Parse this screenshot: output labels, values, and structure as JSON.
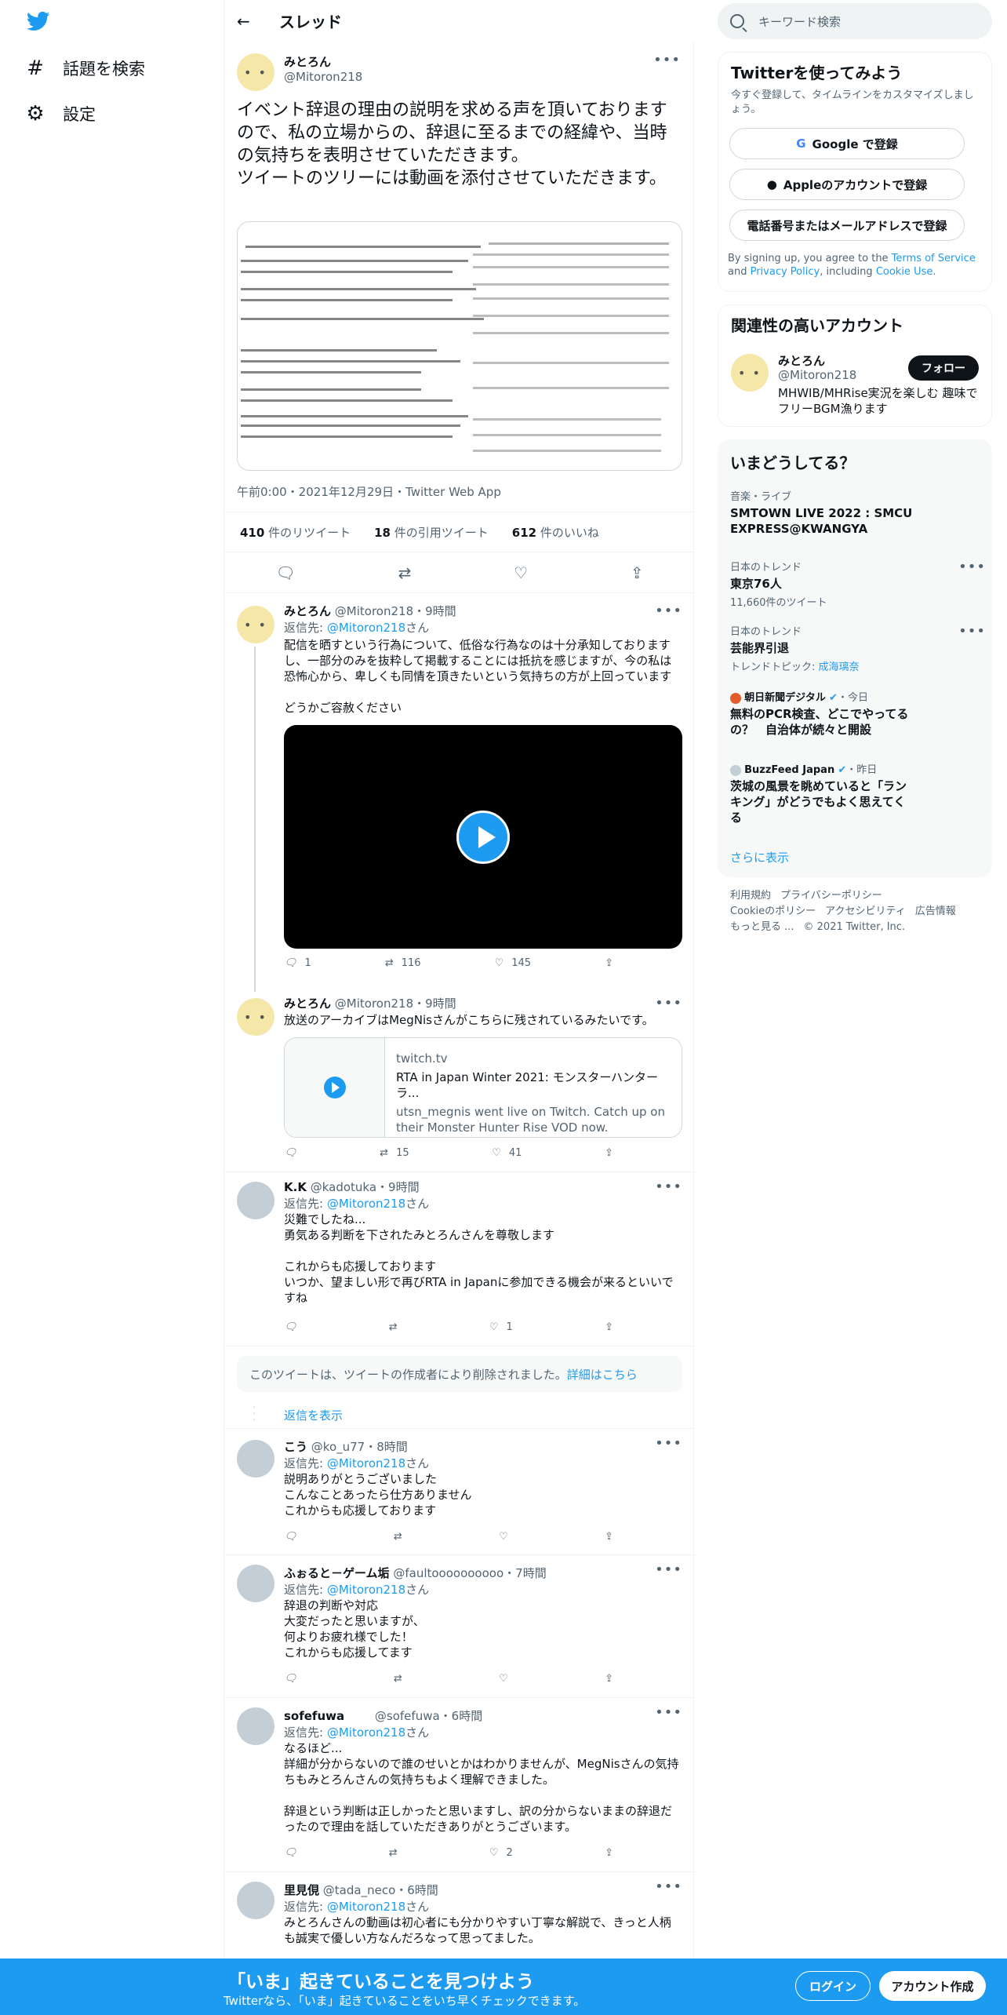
{
  "nav": {
    "explore": "話題を検索",
    "settings": "設定"
  },
  "header": {
    "title": "スレッド"
  },
  "main_tweet": {
    "name": "みとろん",
    "handle": "@Mitoron218",
    "text": "イベント辞退の理由の説明を求める声を頂いておりますので、私の立場からの、辞退に至るまでの経緯や、当時の気持ちを表明させていただきます。\nツイートのツリーには動画を添付させていただきます。",
    "meta": "午前0:00・2021年12月29日・Twitter Web App",
    "retweets": "410",
    "retweets_label": "件のリツイート",
    "quotes": "18",
    "quotes_label": "件の引用ツイート",
    "likes": "612",
    "likes_label": "件のいいね"
  },
  "replies": [
    {
      "name": "みとろん",
      "handle": "@Mitoron218・9時間",
      "reply_to_prefix": "返信先: ",
      "reply_to": "@Mitoron218",
      "reply_to_suffix": "さん",
      "text": "配信を晒すという行為について、低俗な行為なのは十分承知しております し、一部分のみを抜粋して掲載することには抵抗を感じますが、今の私は 恐怖心から、卑しくも同情を頂きたいという気持ちの方が上回っています\n\nどうかご容赦ください",
      "replies": "1",
      "retweets": "116",
      "likes": "145"
    },
    {
      "name": "みとろん",
      "handle": "@Mitoron218・9時間",
      "text": "放送のアーカイブはMegNisさんがこちらに残されているみたいです。",
      "card_domain": "twitch.tv",
      "card_title": "RTA in Japan Winter 2021: モンスターハンターラ...",
      "card_desc": "utsn_megnis went live on Twitch. Catch up on their Monster Hunter Rise VOD now.",
      "replies": "",
      "retweets": "15",
      "likes": "41"
    },
    {
      "name": "K.K",
      "handle": "@kadotuka・9時間",
      "reply_to_prefix": "返信先: ",
      "reply_to": "@Mitoron218",
      "reply_to_suffix": "さん",
      "text": "災難でしたね...\n勇気ある判断を下されたみとろんさんを尊敬します\n\nこれからも応援しております\nいつか、望ましい形で再びRTA in Japanに参加できる機会が来るといいで すね",
      "replies": "",
      "retweets": "",
      "likes": "1"
    },
    {
      "name": "こう",
      "handle": "@ko_u77・8時間",
      "reply_to_prefix": "返信先: ",
      "reply_to": "@Mitoron218",
      "reply_to_suffix": "さん",
      "text": "説明ありがとうございました\nこんなことあったら仕方ありません\nこれからも応援しております",
      "replies": "",
      "retweets": "",
      "likes": ""
    },
    {
      "name": "ふぉると－ゲーム垢",
      "handle": "@faultoooooooooo・7時間",
      "reply_to_prefix": "返信先: ",
      "reply_to": "@Mitoron218",
      "reply_to_suffix": "さん",
      "text": "辞退の判断や対応\n大変だったと思いますが、\n何よりお疲れ様でした！\nこれからも応援してます",
      "replies": "",
      "retweets": "",
      "likes": ""
    },
    {
      "name": "sofefuwa",
      "handle": "@sofefuwa・6時間",
      "reply_to_prefix": "返信先: ",
      "reply_to": "@Mitoron218",
      "reply_to_suffix": "さん",
      "text": "なるほど...\n詳細が分からないので誰のせいとかはわかりませんが、MegNisさんの気持 ちもみとろんさんの気持ちもよく理解できました。\n\n辞退という判断は正しかったと思いますし、訳の分からないままの辞退だ ったので理由を話していただきありがとうございます。",
      "replies": "",
      "retweets": "",
      "likes": "2"
    },
    {
      "name": "里見俔",
      "handle": "@tada_neco・6時間",
      "reply_to_prefix": "返信先: ",
      "reply_to": "@Mitoron218",
      "reply_to_suffix": "さん",
      "text": "みとろんさんの動画は初心者にも分かりやすい丁寧な解説で、きっと人柄 も誠実で優しい方なんだろなって思ってました。"
    }
  ],
  "deleted_notice": "このツイートは、ツイートの作成者により削除されました。",
  "deleted_link": "詳細はこちら",
  "show_replies": "返信を表示",
  "right": {
    "search_placeholder": "キーワード検索",
    "signup_title": "Twitterを使ってみよう",
    "signup_sub": "今すぐ登録して、タイムラインをカスタマイズしましょう。",
    "google_btn": "Google で登録",
    "apple_btn": "Appleのアカウントで登録",
    "phone_btn": "電話番号またはメールアドレスで登録",
    "terms_1": "By signing up, you agree to the ",
    "terms_link": "Terms of Service",
    "terms_2": " and ",
    "privacy_link": "Privacy Policy",
    "terms_3": ", including ",
    "cookie_link": "Cookie Use",
    "terms_4": ".",
    "related_title": "関連性の高いアカウント",
    "related_name": "みとろん",
    "related_handle": "@Mitoron218",
    "related_bio": "MHWIB/MHRise実況を楽しむ 趣味でフリーBGM漁ります",
    "follow": "フォロー",
    "trends_title": "いまどうしてる？",
    "trends": [
      {
        "cat": "音楽・ライブ",
        "title": "SMTOWN LIVE 2022 : SMCU EXPRESS@KWANGYA",
        "count": ""
      },
      {
        "cat": "日本のトレンド",
        "title": "東京76人",
        "count": "11,660件のツイート"
      },
      {
        "cat": "日本のトレンド",
        "title": "芸能界引退",
        "count_prefix": "トレンドトピック: ",
        "count_link": "成海璃奈"
      },
      {
        "cat": "朝日新聞デジタル",
        "cat_suffix": "・今日",
        "title": "無料のPCR検査、どこでやってるの？　自治体が続々と開設"
      },
      {
        "cat": "BuzzFeed Japan",
        "cat_suffix": "・昨日",
        "title": "茨城の風景を眺めていると「ランキング」がどうでもよく思えてくる"
      }
    ],
    "show_more": "さらに表示",
    "footer": [
      "利用規約",
      "プライバシーポリシー",
      "Cookieのポリシー",
      "アクセシビリティ",
      "広告情報",
      "もっと見る ...",
      "© 2021 Twitter, Inc."
    ]
  },
  "bottom": {
    "headline": "「いま」起きていることを見つけよう",
    "sub": "Twitterなら、「いま」起きていることをいち早くチェックできます。",
    "login": "ログイン",
    "signup": "アカウント作成"
  }
}
